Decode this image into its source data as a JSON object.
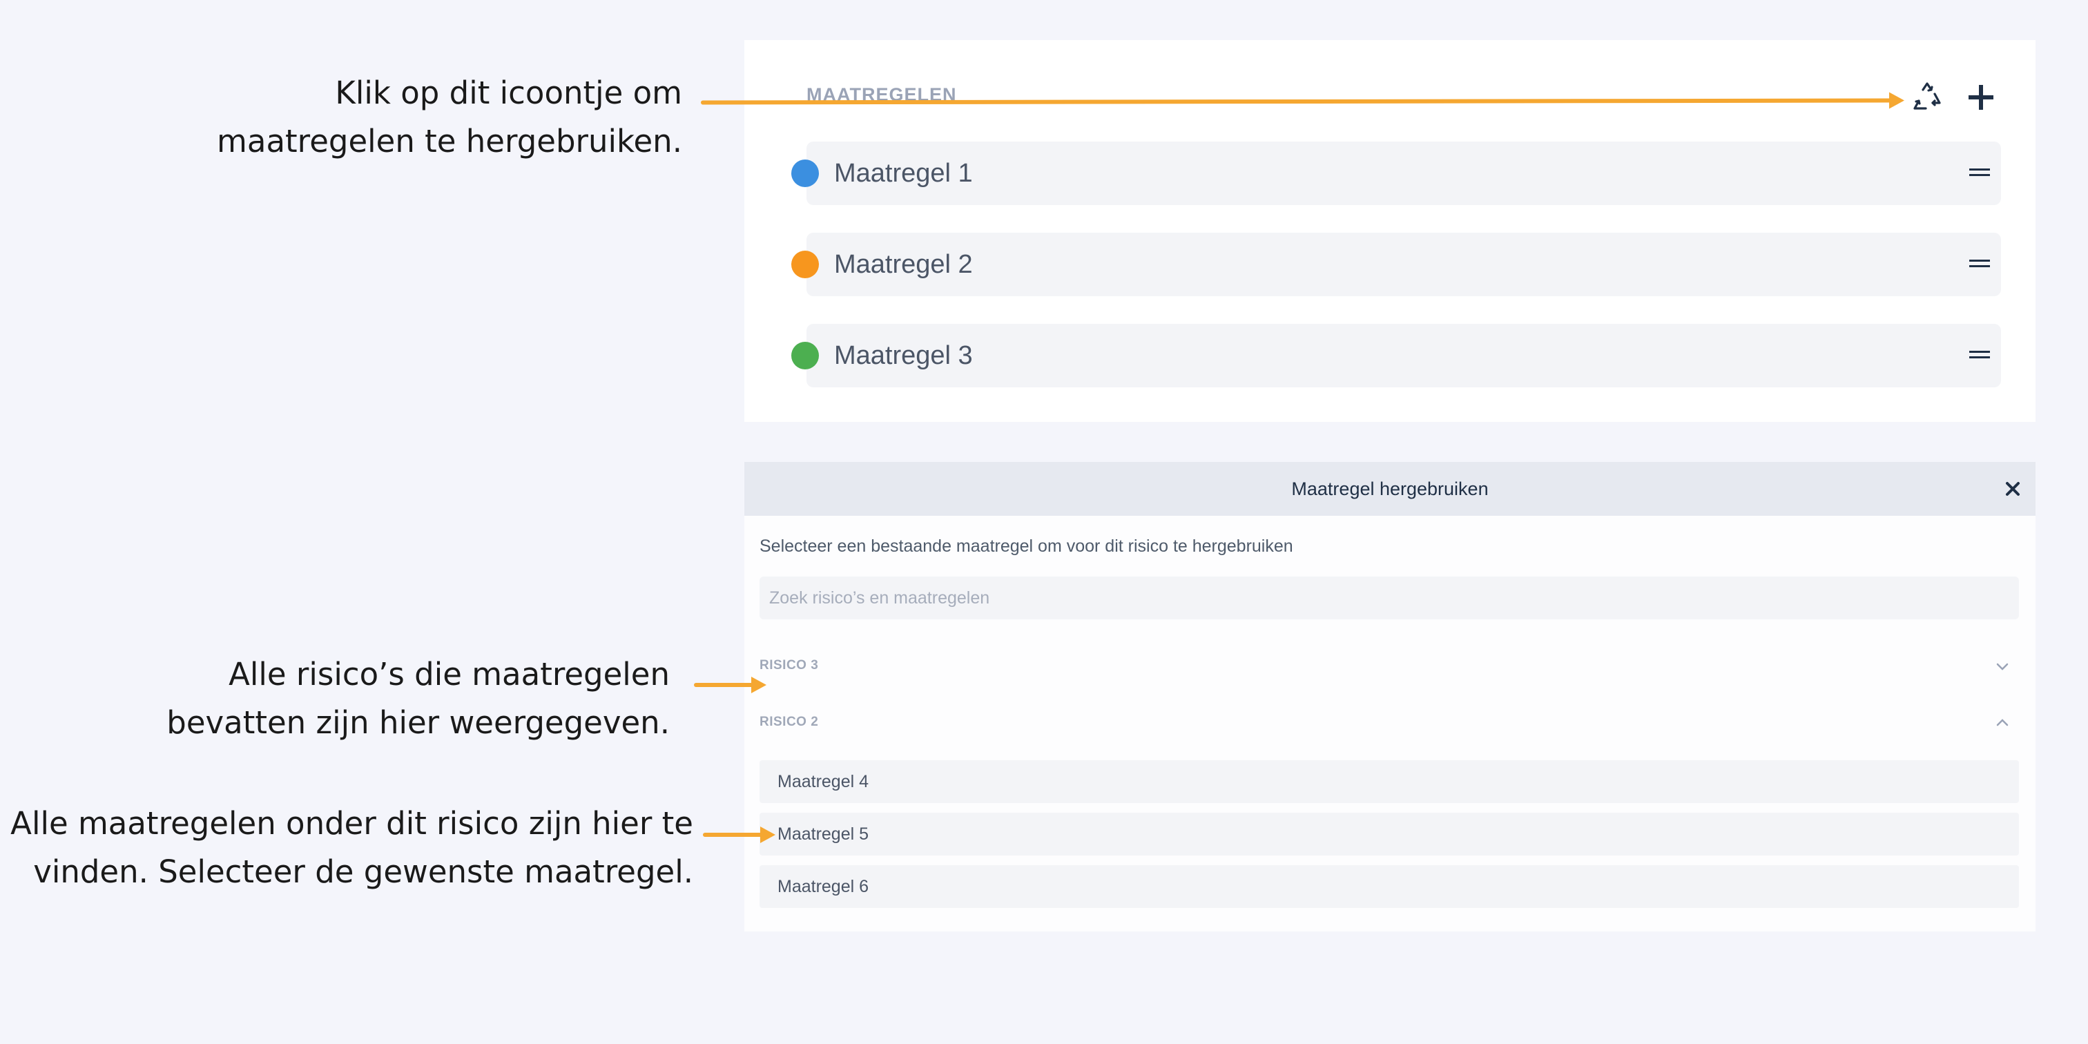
{
  "annotations": {
    "reuse_icon": [
      "Klik op dit icoontje om",
      "maatregelen te hergebruiken."
    ],
    "risks": [
      "Alle risico’s die maatregelen",
      "bevatten zijn hier weergegeven."
    ],
    "measures": [
      "Alle maatregelen onder dit risico zijn hier te",
      "vinden. Selecteer de gewenste maatregel."
    ]
  },
  "panel": {
    "title": "MAATREGELEN",
    "reuse_icon": "recycle-icon",
    "add_icon": "plus-icon",
    "items": [
      {
        "label": "Maatregel 1",
        "color": "#3b8fe0"
      },
      {
        "label": "Maatregel 2",
        "color": "#f7961e"
      },
      {
        "label": "Maatregel 3",
        "color": "#4caf50"
      }
    ]
  },
  "dialog": {
    "title": "Maatregel hergebruiken",
    "description": "Selecteer een bestaande maatregel om voor dit risico te hergebruiken",
    "search_placeholder": "Zoek risico’s en maatregelen",
    "groups": [
      {
        "label": "RISICO 3",
        "expanded": false
      },
      {
        "label": "RISICO 2",
        "expanded": true
      }
    ],
    "items": [
      "Maatregel 4",
      "Maatregel 5",
      "Maatregel 6"
    ]
  },
  "colors": {
    "accent": "#f5a731",
    "background": "#f4f5fb"
  }
}
